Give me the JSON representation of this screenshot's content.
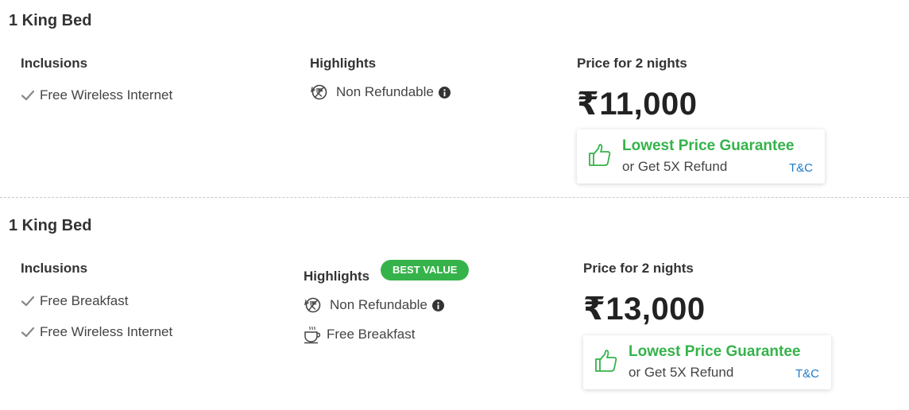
{
  "rooms": [
    {
      "title": "1 King Bed",
      "inclusions_label": "Inclusions",
      "inclusions": [
        "Free Wireless Internet"
      ],
      "highlights_label": "Highlights",
      "highlights": [
        {
          "icon": "non-refundable-icon",
          "text": "Non Refundable",
          "info": true
        }
      ],
      "price_label": "Price for 2 nights",
      "price": "₹11,000",
      "guarantee": {
        "title": "Lowest Price Guarantee",
        "subtitle": "or Get 5X Refund",
        "tc": "T&C"
      }
    },
    {
      "title": "1 King Bed",
      "inclusions_label": "Inclusions",
      "inclusions": [
        "Free Breakfast",
        "Free Wireless Internet"
      ],
      "highlights_label": "Highlights",
      "badge": "BEST VALUE",
      "highlights": [
        {
          "icon": "non-refundable-icon",
          "text": "Non Refundable",
          "info": true
        },
        {
          "icon": "coffee-cup-icon",
          "text": "Free Breakfast",
          "info": false
        }
      ],
      "price_label": "Price for 2 nights",
      "price": "₹13,000",
      "guarantee": {
        "title": "Lowest Price Guarantee",
        "subtitle": "or Get 5X Refund",
        "tc": "T&C"
      }
    }
  ],
  "colors": {
    "accent_green": "#35b34a",
    "link_blue": "#1e7bc8"
  }
}
